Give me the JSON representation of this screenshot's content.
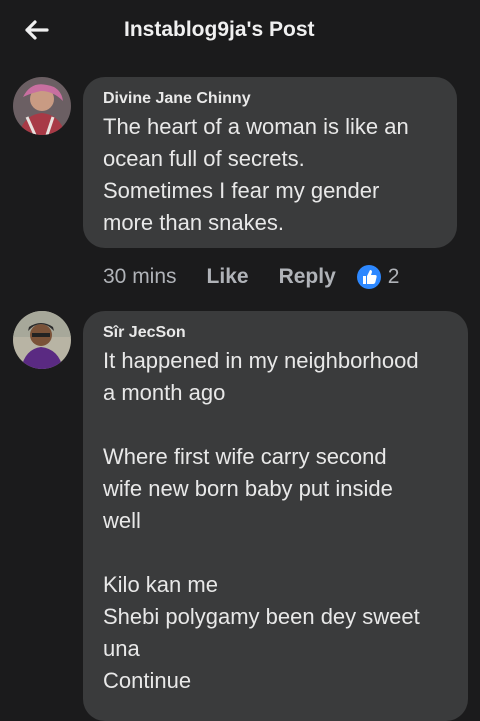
{
  "header": {
    "title": "Instablog9ja's Post",
    "back_icon": "back-arrow-icon"
  },
  "comments": [
    {
      "author": "Divine Jane Chinny",
      "text": "The heart of a woman is like an\nocean full of secrets.\nSometimes I fear my gender\nmore than snakes.",
      "time": "30 mins",
      "like_label": "Like",
      "reply_label": "Reply",
      "reaction_icon": "thumbs-up-icon",
      "reaction_count": "2"
    },
    {
      "author": "Sîr JecSon",
      "text": "It happened in my neighborhood\na month ago\n\nWhere first wife carry second\nwife  new born baby put inside\nwell\n\nKilo kan me\nShebi polygamy been dey sweet\nuna\nContinue"
    }
  ],
  "colors": {
    "background": "#1b1b1c",
    "bubble": "#3a3b3c",
    "muted_text": "#b0b3b8",
    "reaction_blue": "#2d88ff"
  }
}
